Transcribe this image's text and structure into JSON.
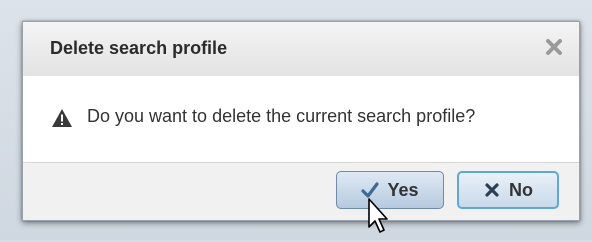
{
  "dialog": {
    "title": "Delete search profile",
    "message": "Do you want to delete the current search profile?",
    "close_icon": "close-icon",
    "warning_icon": "warning-icon"
  },
  "buttons": {
    "yes": {
      "label": "Yes",
      "icon": "check-icon"
    },
    "no": {
      "label": "No",
      "icon": "x-icon"
    }
  },
  "colors": {
    "title_bar": "#e8e8e8",
    "button_bg": "#c9d9ea",
    "focus_border": "#5fa6d9",
    "text": "#333333"
  }
}
